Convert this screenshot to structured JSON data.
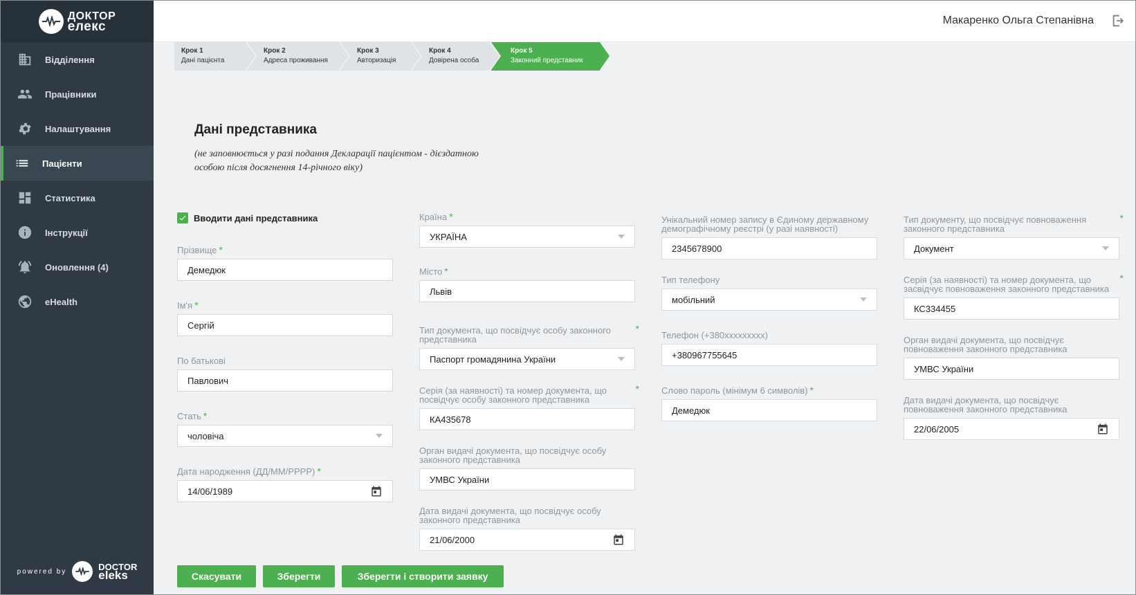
{
  "logo": {
    "line1": "ДОКТОР",
    "line2": "елекс"
  },
  "sidebar": {
    "items": [
      {
        "label": "Відділення",
        "icon": "building-icon"
      },
      {
        "label": "Працівники",
        "icon": "people-icon"
      },
      {
        "label": "Налаштування",
        "icon": "gear-icon"
      },
      {
        "label": "Пацієнти",
        "icon": "list-icon",
        "active": true
      },
      {
        "label": "Статистика",
        "icon": "dashboard-icon"
      },
      {
        "label": "Інструкції",
        "icon": "info-icon"
      },
      {
        "label": "Оновлення (4)",
        "icon": "bell-icon"
      },
      {
        "label": "eHealth",
        "icon": "globe-icon"
      }
    ],
    "powered_by": "powered by",
    "powered_brand_1": "DOCTOR",
    "powered_brand_2": "eleks"
  },
  "header": {
    "user_name": "Макаренко Ольга Степанівна"
  },
  "steps": [
    {
      "title": "Крок 1",
      "label": "Дані пацієнта"
    },
    {
      "title": "Крок 2",
      "label": "Адреса проживання"
    },
    {
      "title": "Крок 3",
      "label": "Авторизація"
    },
    {
      "title": "Крок 4",
      "label": "Довірена особа"
    },
    {
      "title": "Крок 5",
      "label": "Законний представник",
      "active": true
    }
  ],
  "section": {
    "title": "Дані представника",
    "note": "(не заповнюється у разі подання Декларації пацієнтом - дієздатною особою після досягнення 14-річного віку)"
  },
  "checkbox": {
    "label": "Вводити дані представника",
    "checked": true
  },
  "form": {
    "surname": {
      "label": "Прізвище",
      "value": "Демедюк"
    },
    "name": {
      "label": "Ім'я",
      "value": "Сергій"
    },
    "patronymic": {
      "label": "По батькові",
      "value": "Павлович"
    },
    "gender": {
      "label": "Стать",
      "value": "чоловіча"
    },
    "birth_date": {
      "label": "Дата народження (ДД/ММ/РРРР)",
      "value": "14/06/1989"
    },
    "country": {
      "label": "Країна",
      "value": "УКРАЇНА"
    },
    "city": {
      "label": "Місто",
      "value": "Львів"
    },
    "id_doc_type": {
      "label": "Тип документа, що посвідчує особу законного представника",
      "value": "Паспорт громадянина України"
    },
    "id_doc_number": {
      "label": "Серія (за наявності) та номер документа, що посвідчує особу законного представника",
      "value": "КА435678"
    },
    "id_doc_issuer": {
      "label": "Орган видачі документа, що посвідчує особу законного представника",
      "value": "УМВС України"
    },
    "id_doc_date": {
      "label": "Дата видачі документа, що посвідчує особу законного представника",
      "value": "21/06/2000"
    },
    "registry_number": {
      "label": "Унікальний номер запису в Єдиному державному демографічному реєстрі (у разі наявності)",
      "value": "2345678900"
    },
    "phone_type": {
      "label": "Тип телефону",
      "value": "мобільний"
    },
    "phone": {
      "label": "Телефон (+380xxxxxxxxx)",
      "value": "+380967755645"
    },
    "password": {
      "label": "Слово пароль (мінімум 6 символів)",
      "value": "Демедюк"
    },
    "auth_doc_type": {
      "label": "Тип документу, що посвідчує повноваження законного представника",
      "value": "Документ"
    },
    "auth_doc_number": {
      "label": "Серія (за наявності) та номер документа, що засвідчує повноваження законного представника",
      "value": "КС334455"
    },
    "auth_doc_issuer": {
      "label": "Орган видачі документа, що посвідчує повноваження законного представника",
      "value": "УМВС України"
    },
    "auth_doc_date": {
      "label": "Дата видачі документа, що посвідчує повноваження законного представника",
      "value": "22/06/2005"
    }
  },
  "buttons": {
    "cancel": "Скасувати",
    "save": "Зберегти",
    "save_create": "Зберегти і створити заявку"
  },
  "colors": {
    "accent": "#4caf50",
    "sidebar": "#2f3a44"
  }
}
